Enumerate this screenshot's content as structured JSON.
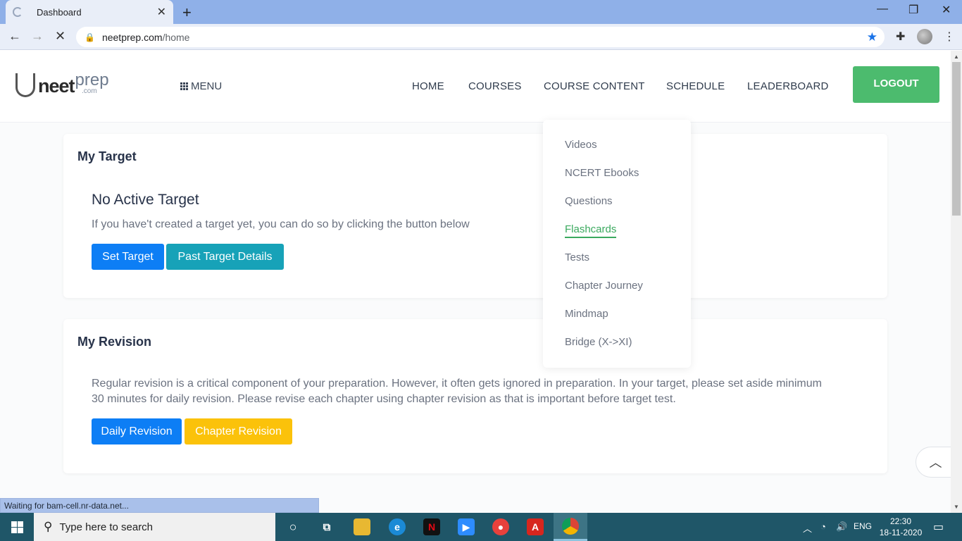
{
  "browser": {
    "tab_title": "Dashboard",
    "url_host": "neetprep.com",
    "url_path": "/home",
    "status_text": "Waiting for bam-cell.nr-data.net..."
  },
  "site": {
    "logo": {
      "neet": "neet",
      "prep": "prep",
      "dotcom": ".com"
    },
    "menu_label": "MENU",
    "nav": [
      "HOME",
      "COURSES",
      "COURSE CONTENT",
      "SCHEDULE",
      "LEADERBOARD"
    ],
    "logout_label": "LOGOUT"
  },
  "dropdown": {
    "items": [
      "Videos",
      "NCERT Ebooks",
      "Questions",
      "Flashcards",
      "Tests",
      "Chapter Journey",
      "Mindmap",
      "Bridge (X->XI)"
    ],
    "active": "Flashcards"
  },
  "target_card": {
    "title": "My Target",
    "heading": "No Active Target",
    "text": "If you have't created a target yet, you can do so by clicking the button below",
    "set_target_label": "Set Target",
    "past_target_label": "Past Target Details"
  },
  "revision_card": {
    "title": "My Revision",
    "text_line1": "Regular revision is a critical component of your preparation. However, it often gets ignored in preparation. In your target, please set aside minimum",
    "text_line2": "30 minutes for daily revision. Please revise each chapter using chapter revision as that is important before target test.",
    "daily_label": "Daily Revision",
    "chapter_label": "Chapter Revision"
  },
  "taskbar": {
    "search_placeholder": "Type here to search",
    "lang": "ENG",
    "time": "22:30",
    "date": "18-11-2020"
  },
  "colors": {
    "logout_green": "#4cbb6e",
    "primary_blue": "#0d7ef5",
    "teal": "#17a2b8",
    "yellow": "#fbc20a",
    "active_link_green": "#3aa95e"
  }
}
